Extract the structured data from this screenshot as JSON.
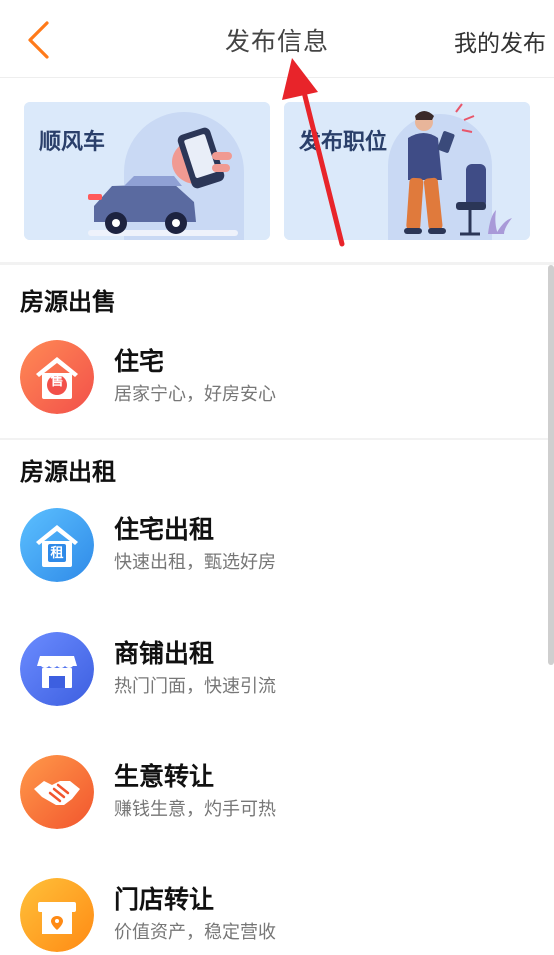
{
  "header": {
    "title": "发布信息",
    "right_action": "我的发布",
    "back_icon": "chevron-left-icon",
    "accent_color": "#ff7a1a"
  },
  "banners": [
    {
      "label": "顺风车",
      "icon": "car-illustration"
    },
    {
      "label": "发布职位",
      "icon": "office-worker-illustration"
    }
  ],
  "sections": [
    {
      "title": "房源出售",
      "items": [
        {
          "title": "住宅",
          "subtitle": "居家宁心，好房安心",
          "icon": "house-sale-icon",
          "badge": "售",
          "color": "#ff6a4d"
        }
      ]
    },
    {
      "title": "房源出租",
      "items": [
        {
          "title": "住宅出租",
          "subtitle": "快速出租，甄选好房",
          "icon": "house-rent-icon",
          "badge": "租",
          "color": "#3fa1f5"
        },
        {
          "title": "商铺出租",
          "subtitle": "热门门面，快速引流",
          "icon": "storefront-icon",
          "color": "#4a72ee"
        },
        {
          "title": "生意转让",
          "subtitle": "赚钱生意，灼手可热",
          "icon": "handshake-icon",
          "color": "#ff7a3a"
        },
        {
          "title": "门店转让",
          "subtitle": "价值资产，稳定营收",
          "icon": "shop-transfer-icon",
          "color": "#ffa51f"
        }
      ]
    }
  ]
}
